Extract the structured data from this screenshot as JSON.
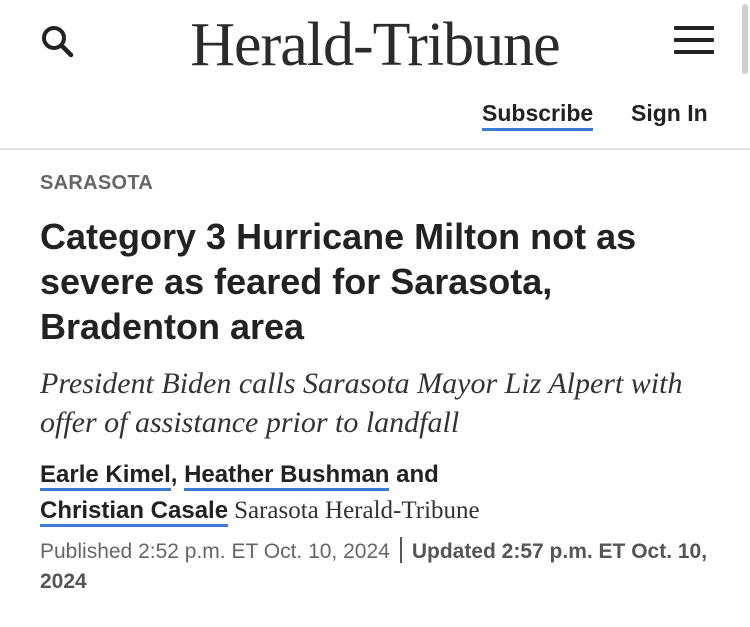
{
  "header": {
    "logo": "Herald-Tribune",
    "subscribe_label": "Subscribe",
    "signin_label": "Sign In",
    "icons": {
      "search": "search-icon",
      "menu": "hamburger-menu-icon"
    }
  },
  "article": {
    "section": "SARASOTA",
    "headline": "Category 3 Hurricane Milton not as severe as feared for Sarasota, Bradenton area",
    "subhead": "President Biden calls Sarasota Mayor Liz Alpert with offer of assistance prior to landfall",
    "authors": [
      "Earle Kimel",
      "Heather Bushman",
      "Christian Casale"
    ],
    "byline_comma": ",",
    "byline_and": "and",
    "source": "Sarasota Herald-Tribune",
    "published": "Published 2:52 p.m. ET Oct. 10, 2024",
    "updated": "Updated 2:57 p.m. ET Oct. 10, 2024"
  },
  "colors": {
    "link_underline": "#3a7bd5",
    "text": "#222222",
    "muted": "#666666"
  }
}
